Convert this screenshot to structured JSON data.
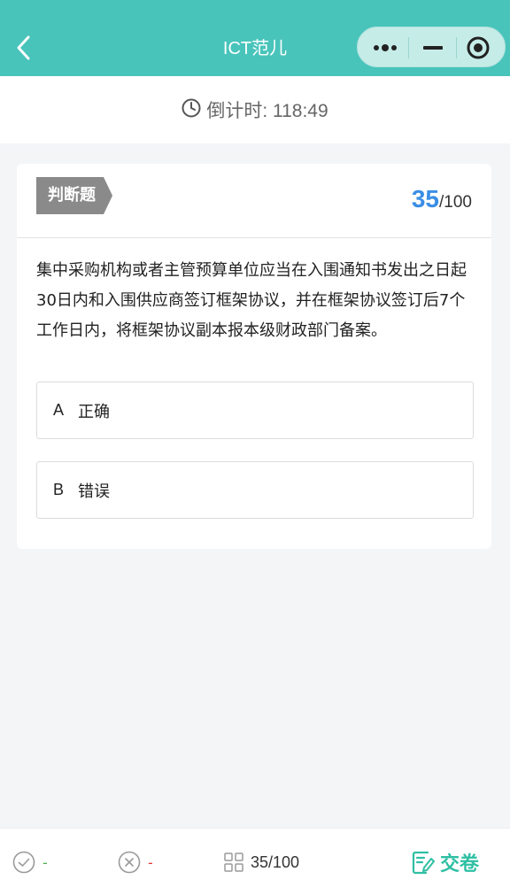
{
  "header": {
    "title": "ICT范儿",
    "bg_color": "#48c4bb",
    "back_icon": "chevron-left-icon",
    "capsule_icons": [
      "more-dots-icon",
      "minimize-icon",
      "close-target-icon"
    ]
  },
  "timer": {
    "icon": "clock-icon",
    "text": "倒计时: 118:49"
  },
  "question": {
    "type_label": "判断题",
    "current": "35",
    "total": "/100",
    "text": "集中采购机构或者主管预算单位应当在入围通知书发出之日起30日内和入围供应商签订框架协议，并在框架协议签订后7个工作日内，将框架协议副本报本级财政部门备案。",
    "options": [
      {
        "letter": "A",
        "text": "正确"
      },
      {
        "letter": "B",
        "text": "错误"
      }
    ]
  },
  "bottom_bar": {
    "correct_count": "-",
    "wrong_count": "-",
    "progress": "35/100",
    "submit_label": "交卷",
    "correct_color": "#4caf50",
    "wrong_color": "#e53935",
    "accent_color": "#2fbfa4"
  }
}
